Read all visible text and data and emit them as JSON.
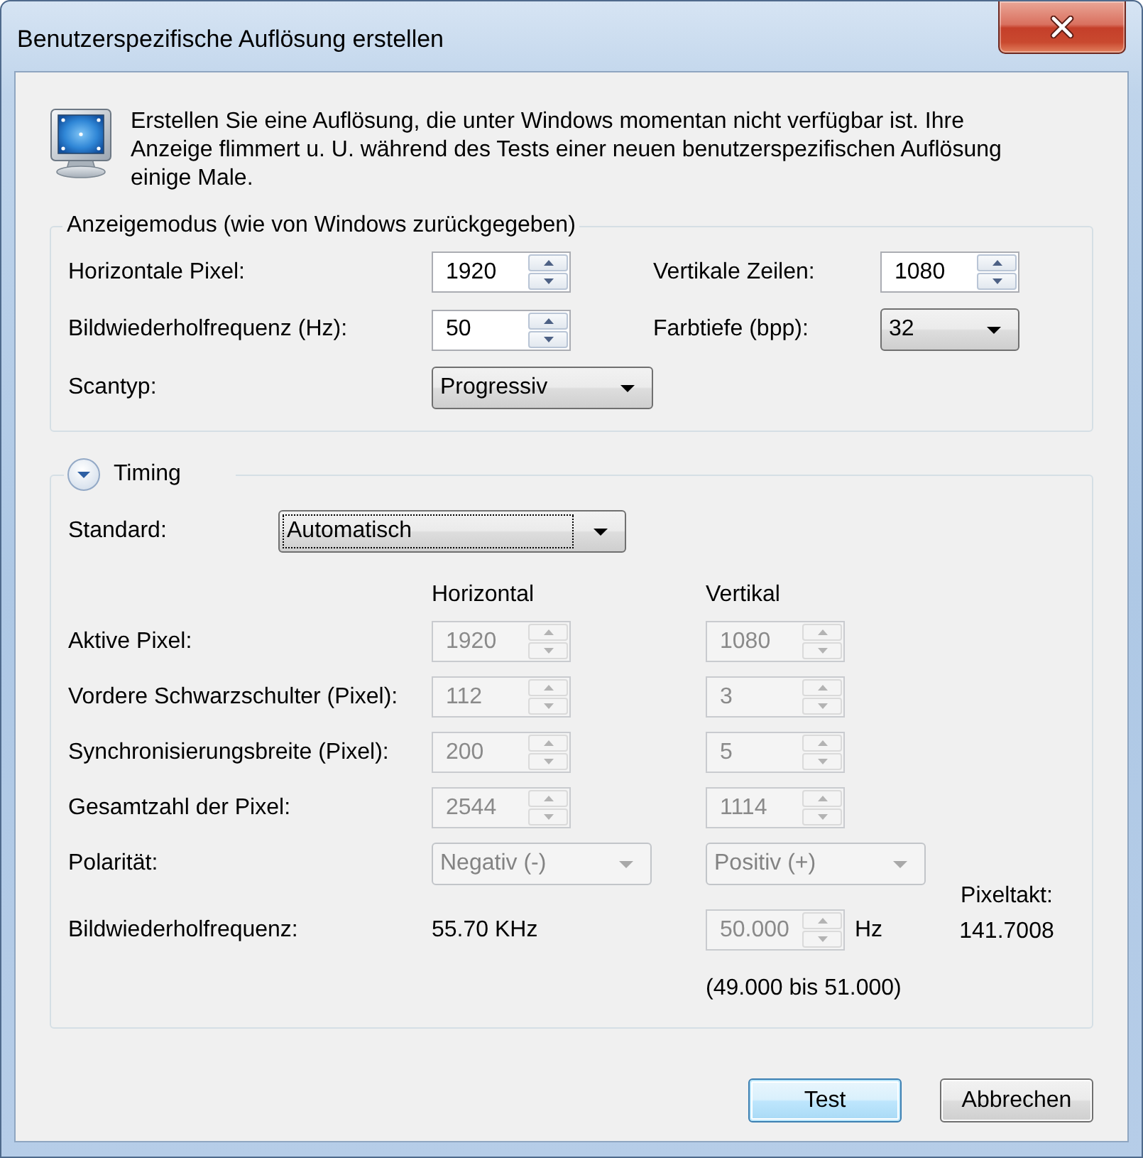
{
  "window": {
    "title": "Benutzerspezifische Auflösung erstellen"
  },
  "intro": {
    "text": "Erstellen Sie eine Auflösung, die unter Windows momentan nicht verfügbar ist. Ihre Anzeige flimmert u. U. während des Tests einer neuen benutzerspezifischen Auflösung einige Male."
  },
  "display_mode": {
    "title": "Anzeigemodus (wie von Windows zurückgegeben)",
    "fields": [
      {
        "kind": "spin",
        "label": "Horizontale Pixel:",
        "value": "1920"
      },
      {
        "kind": "spin",
        "label": "Vertikale Zeilen:",
        "value": "1080"
      },
      {
        "kind": "spin",
        "label": "Bildwiederholfrequenz (Hz):",
        "value": "50"
      },
      {
        "kind": "dropdown",
        "label": "Farbtiefe (bpp):",
        "value": "32"
      },
      {
        "kind": "dropdown",
        "label": "Scantyp:",
        "value": "Progressiv"
      }
    ]
  },
  "timing": {
    "title": "Timing",
    "expanded": true,
    "standard": {
      "label": "Standard:",
      "value": "Automatisch",
      "focused": true
    },
    "columns": [
      "Horizontal",
      "Vertikal"
    ],
    "rows": [
      {
        "kind": "spin",
        "label": "Aktive Pixel:",
        "horizontal": "1920",
        "vertical": "1080",
        "disabled": true
      },
      {
        "kind": "spin",
        "label": "Vordere Schwarzschulter (Pixel):",
        "horizontal": "112",
        "vertical": "3",
        "disabled": true
      },
      {
        "kind": "spin",
        "label": "Synchronisierungsbreite (Pixel):",
        "horizontal": "200",
        "vertical": "5",
        "disabled": true
      },
      {
        "kind": "spin",
        "label": "Gesamtzahl der Pixel:",
        "horizontal": "2544",
        "vertical": "1114",
        "disabled": true
      },
      {
        "kind": "dropdown",
        "label": "Polarität:",
        "horizontal": "Negativ (-)",
        "vertical": "Positiv (+)",
        "disabled": true
      }
    ],
    "refresh_rate": {
      "label": "Bildwiederholfrequenz:",
      "horizontal": "55.70 KHz",
      "vertical": "50.000",
      "unit": "Hz",
      "range": "(49.000 bis 51.000)",
      "disabled": true
    },
    "pixel_clock": {
      "label": "Pixeltakt:",
      "value": "141.7008"
    }
  },
  "buttons": [
    {
      "label": "Test",
      "default": true
    },
    {
      "label": "Abbrechen",
      "default": false
    }
  ]
}
